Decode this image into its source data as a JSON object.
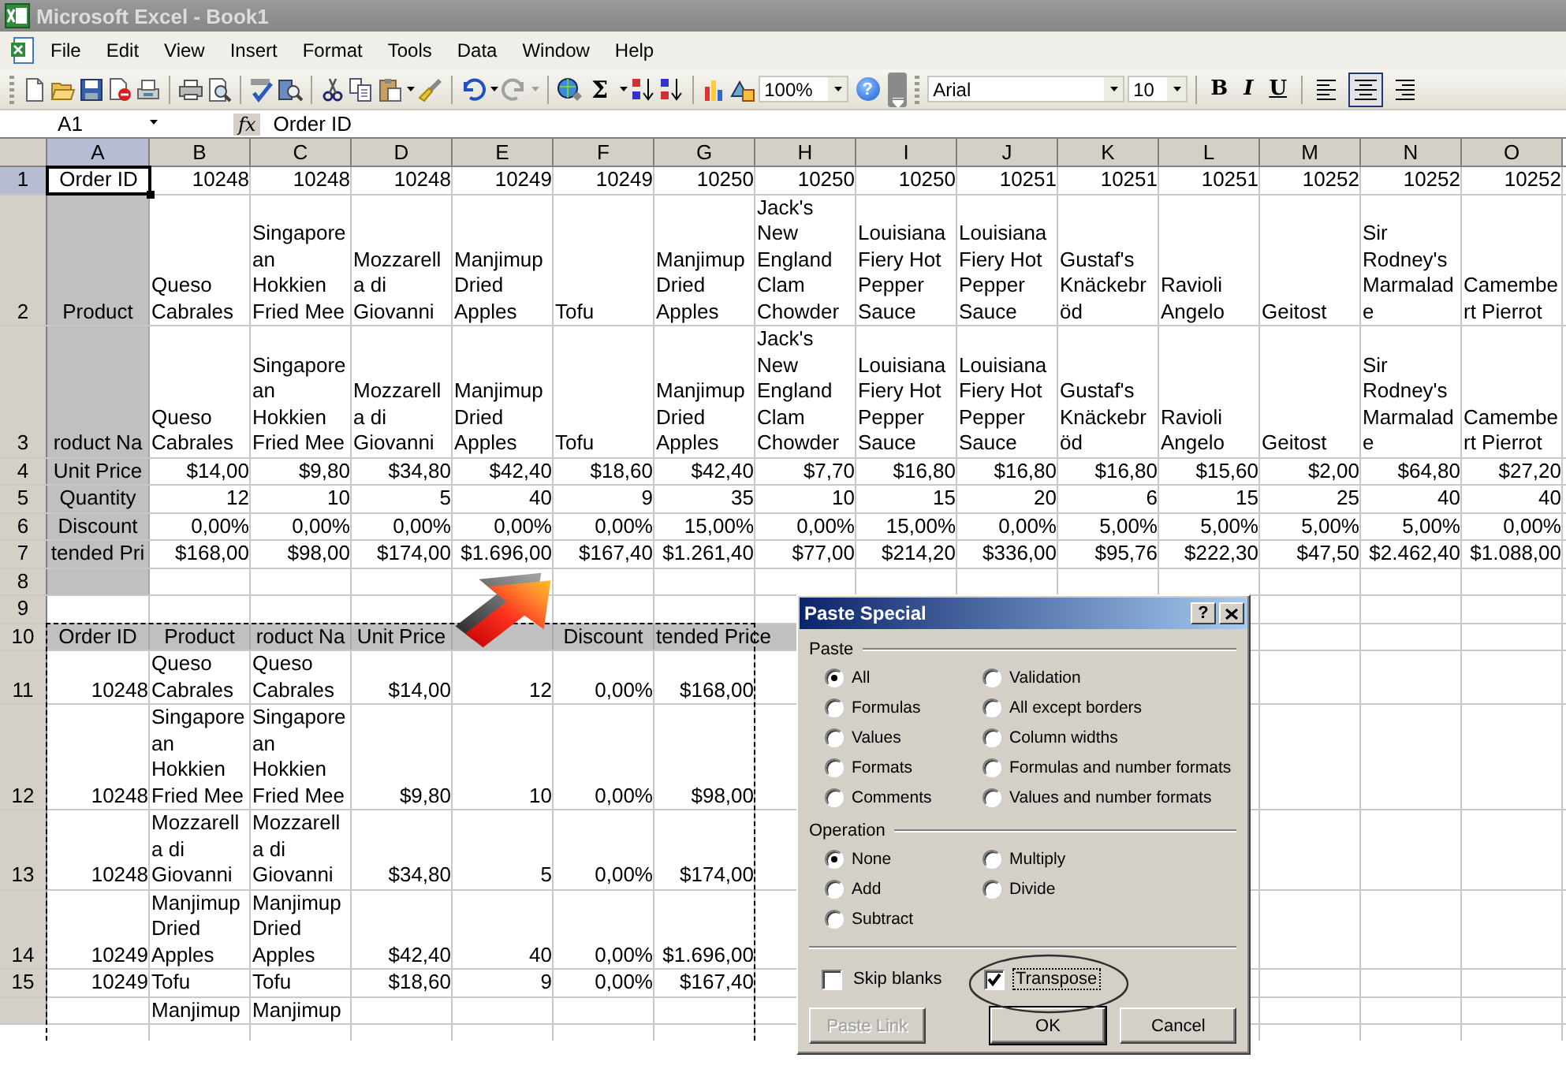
{
  "window": {
    "title": "Microsoft Excel - Book1"
  },
  "menu": [
    {
      "label": "File"
    },
    {
      "label": "Edit"
    },
    {
      "label": "View"
    },
    {
      "label": "Insert"
    },
    {
      "label": "Format"
    },
    {
      "label": "Tools"
    },
    {
      "label": "Data"
    },
    {
      "label": "Window"
    },
    {
      "label": "Help"
    }
  ],
  "toolbar": {
    "undo": {
      "disabled": false
    },
    "redo": {
      "disabled": true
    },
    "autosum": "Σ",
    "zoom": "100%",
    "help": "?",
    "font": "Arial",
    "font_size": "10",
    "bold": "B",
    "italic": "I",
    "underline": "U",
    "alignment": [
      {
        "selected": false
      },
      {
        "selected": true
      },
      {
        "selected": false
      }
    ]
  },
  "formula_bar": {
    "name_box": "A1",
    "function_label": "fx",
    "formula": "Order ID"
  },
  "sheet": {
    "columns": [
      {
        "label": "A",
        "selected": true
      },
      {
        "label": "B",
        "selected": false
      },
      {
        "label": "C",
        "selected": false
      },
      {
        "label": "D",
        "selected": false
      },
      {
        "label": "E",
        "selected": false
      },
      {
        "label": "F",
        "selected": false
      },
      {
        "label": "G",
        "selected": false
      },
      {
        "label": "H",
        "selected": false
      },
      {
        "label": "I",
        "selected": false
      },
      {
        "label": "J",
        "selected": false
      },
      {
        "label": "K",
        "selected": false
      },
      {
        "label": "L",
        "selected": false
      },
      {
        "label": "M",
        "selected": false
      },
      {
        "label": "N",
        "selected": false
      },
      {
        "label": "O",
        "selected": false
      }
    ],
    "rows": [
      {
        "number": "1",
        "selected": true,
        "kind": "number",
        "cells": [
          {
            "text": "Order ID",
            "kind": "label",
            "active": true
          },
          "10248",
          "10248",
          "10248",
          "10249",
          "10249",
          "10250",
          "10250",
          "10250",
          "10251",
          "10251",
          "10251",
          "10252",
          "10252",
          "10252"
        ]
      },
      {
        "number": "2",
        "selected": false,
        "kind": "text",
        "cells": [
          {
            "text": "Product",
            "kind": "label",
            "shaded": true
          },
          "Queso\nCabrales",
          "Singapore\nan\nHokkien\nFried Mee",
          "Mozzarell\na di\nGiovanni",
          "Manjimup\nDried\nApples",
          "Tofu",
          "Manjimup\nDried\nApples",
          "Jack's\nNew\nEngland\nClam\nChowder",
          "Louisiana\nFiery Hot\nPepper\nSauce",
          "Louisiana\nFiery Hot\nPepper\nSauce",
          "Gustaf's\nKnäckebr\nöd",
          "Ravioli\nAngelo",
          "Geitost",
          "Sir\nRodney's\nMarmalad\ne",
          "Camembe\nrt Pierrot"
        ]
      },
      {
        "number": "3",
        "selected": false,
        "kind": "text",
        "cells": [
          {
            "text": "roduct Na",
            "kind": "label",
            "shaded": true
          },
          "Queso\nCabrales",
          "Singapore\nan\nHokkien\nFried Mee",
          "Mozzarell\na di\nGiovanni",
          "Manjimup\nDried\nApples",
          "Tofu",
          "Manjimup\nDried\nApples",
          "Jack's\nNew\nEngland\nClam\nChowder",
          "Louisiana\nFiery Hot\nPepper\nSauce",
          "Louisiana\nFiery Hot\nPepper\nSauce",
          "Gustaf's\nKnäckebr\nöd",
          "Ravioli\nAngelo",
          "Geitost",
          "Sir\nRodney's\nMarmalad\ne",
          "Camembe\nrt Pierrot"
        ]
      },
      {
        "number": "4",
        "selected": false,
        "kind": "number",
        "cells": [
          {
            "text": "Unit Price",
            "kind": "label",
            "shaded": true
          },
          "$14,00",
          "$9,80",
          "$34,80",
          "$42,40",
          "$18,60",
          "$42,40",
          "$7,70",
          "$16,80",
          "$16,80",
          "$16,80",
          "$15,60",
          "$2,00",
          "$64,80",
          "$27,20"
        ]
      },
      {
        "number": "5",
        "selected": false,
        "kind": "number",
        "cells": [
          {
            "text": "Quantity",
            "kind": "label",
            "shaded": true
          },
          "12",
          "10",
          "5",
          "40",
          "9",
          "35",
          "10",
          "15",
          "20",
          "6",
          "15",
          "25",
          "40",
          "40"
        ]
      },
      {
        "number": "6",
        "selected": false,
        "kind": "number",
        "cells": [
          {
            "text": "Discount",
            "kind": "label",
            "shaded": true
          },
          "0,00%",
          "0,00%",
          "0,00%",
          "0,00%",
          "0,00%",
          "15,00%",
          "0,00%",
          "15,00%",
          "0,00%",
          "5,00%",
          "5,00%",
          "5,00%",
          "5,00%",
          "0,00%"
        ]
      },
      {
        "number": "7",
        "selected": false,
        "kind": "number",
        "cells": [
          {
            "text": "tended Pri",
            "kind": "label",
            "shaded": true
          },
          "$168,00",
          "$98,00",
          "$174,00",
          "$1.696,00",
          "$167,40",
          "$1.261,40",
          "$77,00",
          "$214,20",
          "$336,00",
          "$95,76",
          "$222,30",
          "$47,50",
          "$2.462,40",
          "$1.088,00"
        ]
      },
      {
        "number": "8",
        "selected": false,
        "kind": "text",
        "cells": [
          {
            "shaded": true
          }
        ]
      },
      {
        "number": "9",
        "selected": false,
        "kind": "text",
        "cells": []
      },
      {
        "number": "10",
        "selected": false,
        "kind": "label",
        "cells": [
          {
            "text": "Order ID",
            "shaded": true,
            "copied": true
          },
          {
            "text": "Product",
            "shaded": true,
            "copied": true
          },
          {
            "text": "roduct Na",
            "shaded": true,
            "copied": true
          },
          {
            "text": "Unit Price",
            "shaded": true,
            "copied": true
          },
          {
            "shaded": true,
            "copied": true
          },
          {
            "text": "Discount",
            "shaded": true,
            "copied": true
          },
          {
            "text": "tended Price",
            "shaded": true,
            "kind": "text",
            "copied": true
          }
        ]
      },
      {
        "number": "11",
        "selected": false,
        "kind": "number",
        "cells": [
          {
            "text": "10248",
            "copied": true
          },
          {
            "text": "Queso\nCabrales",
            "kind": "text",
            "copied": true
          },
          {
            "text": "Queso\nCabrales",
            "kind": "text",
            "copied": true
          },
          {
            "text": "$14,00",
            "copied": true
          },
          {
            "text": "12",
            "copied": true
          },
          {
            "text": "0,00%",
            "copied": true
          },
          {
            "text": "$168,00",
            "copied": true
          }
        ]
      },
      {
        "number": "12",
        "selected": false,
        "kind": "number",
        "cells": [
          {
            "text": "10248",
            "copied": true
          },
          {
            "text": "Singapore\nan\nHokkien\nFried Mee",
            "kind": "text",
            "copied": true
          },
          {
            "text": "Singapore\nan\nHokkien\nFried Mee",
            "kind": "text",
            "copied": true
          },
          {
            "text": "$9,80",
            "copied": true
          },
          {
            "text": "10",
            "copied": true
          },
          {
            "text": "0,00%",
            "copied": true
          },
          {
            "text": "$98,00",
            "copied": true
          }
        ]
      },
      {
        "number": "13",
        "selected": false,
        "kind": "number",
        "cells": [
          {
            "text": "10248",
            "copied": true
          },
          {
            "text": "Mozzarell\na di\nGiovanni",
            "kind": "text",
            "copied": true
          },
          {
            "text": "Mozzarell\na di\nGiovanni",
            "kind": "text",
            "copied": true
          },
          {
            "text": "$34,80",
            "copied": true
          },
          {
            "text": "5",
            "copied": true
          },
          {
            "text": "0,00%",
            "copied": true
          },
          {
            "text": "$174,00",
            "copied": true
          }
        ]
      },
      {
        "number": "14",
        "selected": false,
        "kind": "number",
        "cells": [
          {
            "text": "10249",
            "copied": true
          },
          {
            "text": "Manjimup\nDried\nApples",
            "kind": "text",
            "copied": true
          },
          {
            "text": "Manjimup\nDried\nApples",
            "kind": "text",
            "copied": true
          },
          {
            "text": "$42,40",
            "copied": true
          },
          {
            "text": "40",
            "copied": true
          },
          {
            "text": "0,00%",
            "copied": true
          },
          {
            "text": "$1.696,00",
            "copied": true
          }
        ]
      },
      {
        "number": "15",
        "selected": false,
        "kind": "number",
        "cells": [
          {
            "text": "10249",
            "copied": true
          },
          {
            "text": "Tofu",
            "kind": "text",
            "copied": true
          },
          {
            "text": "Tofu",
            "kind": "text",
            "copied": true
          },
          {
            "text": "$18,60",
            "copied": true
          },
          {
            "text": "9",
            "copied": true
          },
          {
            "text": "0,00%",
            "copied": true
          },
          {
            "text": "$167,40",
            "copied": true
          }
        ]
      },
      {
        "selected": false,
        "kind": "text",
        "cells": [
          {
            "copied": true
          },
          {
            "text": "Manjimup",
            "copied": true
          },
          {
            "text": "Manjimup",
            "copied": true
          },
          {
            "copied": true
          },
          {
            "copied": true
          },
          {
            "copied": true
          },
          {
            "copied": true
          }
        ]
      }
    ]
  },
  "paste_special": {
    "title": "Paste Special",
    "help": "?",
    "paste": {
      "label": "Paste",
      "options": [
        {
          "label": "All",
          "selected": true
        },
        {
          "label": "Formulas",
          "selected": false
        },
        {
          "label": "Values",
          "selected": false
        },
        {
          "label": "Formats",
          "selected": false
        },
        {
          "label": "Comments",
          "selected": false
        },
        {
          "label": "Validation",
          "selected": false
        },
        {
          "label": "All except borders",
          "selected": false
        },
        {
          "label": "Column widths",
          "selected": false
        },
        {
          "label": "Formulas and number formats",
          "selected": false
        },
        {
          "label": "Values and number formats",
          "selected": false
        }
      ]
    },
    "operation": {
      "label": "Operation",
      "options": [
        {
          "label": "None",
          "selected": true
        },
        {
          "label": "Add",
          "selected": false
        },
        {
          "label": "Subtract",
          "selected": false
        },
        {
          "label": "Multiply",
          "selected": false
        },
        {
          "label": "Divide",
          "selected": false
        }
      ]
    },
    "checkboxes": [
      {
        "label": "Skip blanks",
        "checked": false,
        "focused": false,
        "circled": false
      },
      {
        "label": "Transpose",
        "checked": true,
        "focused": true,
        "circled": true
      }
    ],
    "buttons": [
      {
        "label": "Paste Link",
        "disabled": true,
        "default": false
      },
      {
        "label": "OK",
        "disabled": false,
        "default": true
      },
      {
        "label": "Cancel",
        "disabled": false,
        "default": false
      }
    ]
  }
}
